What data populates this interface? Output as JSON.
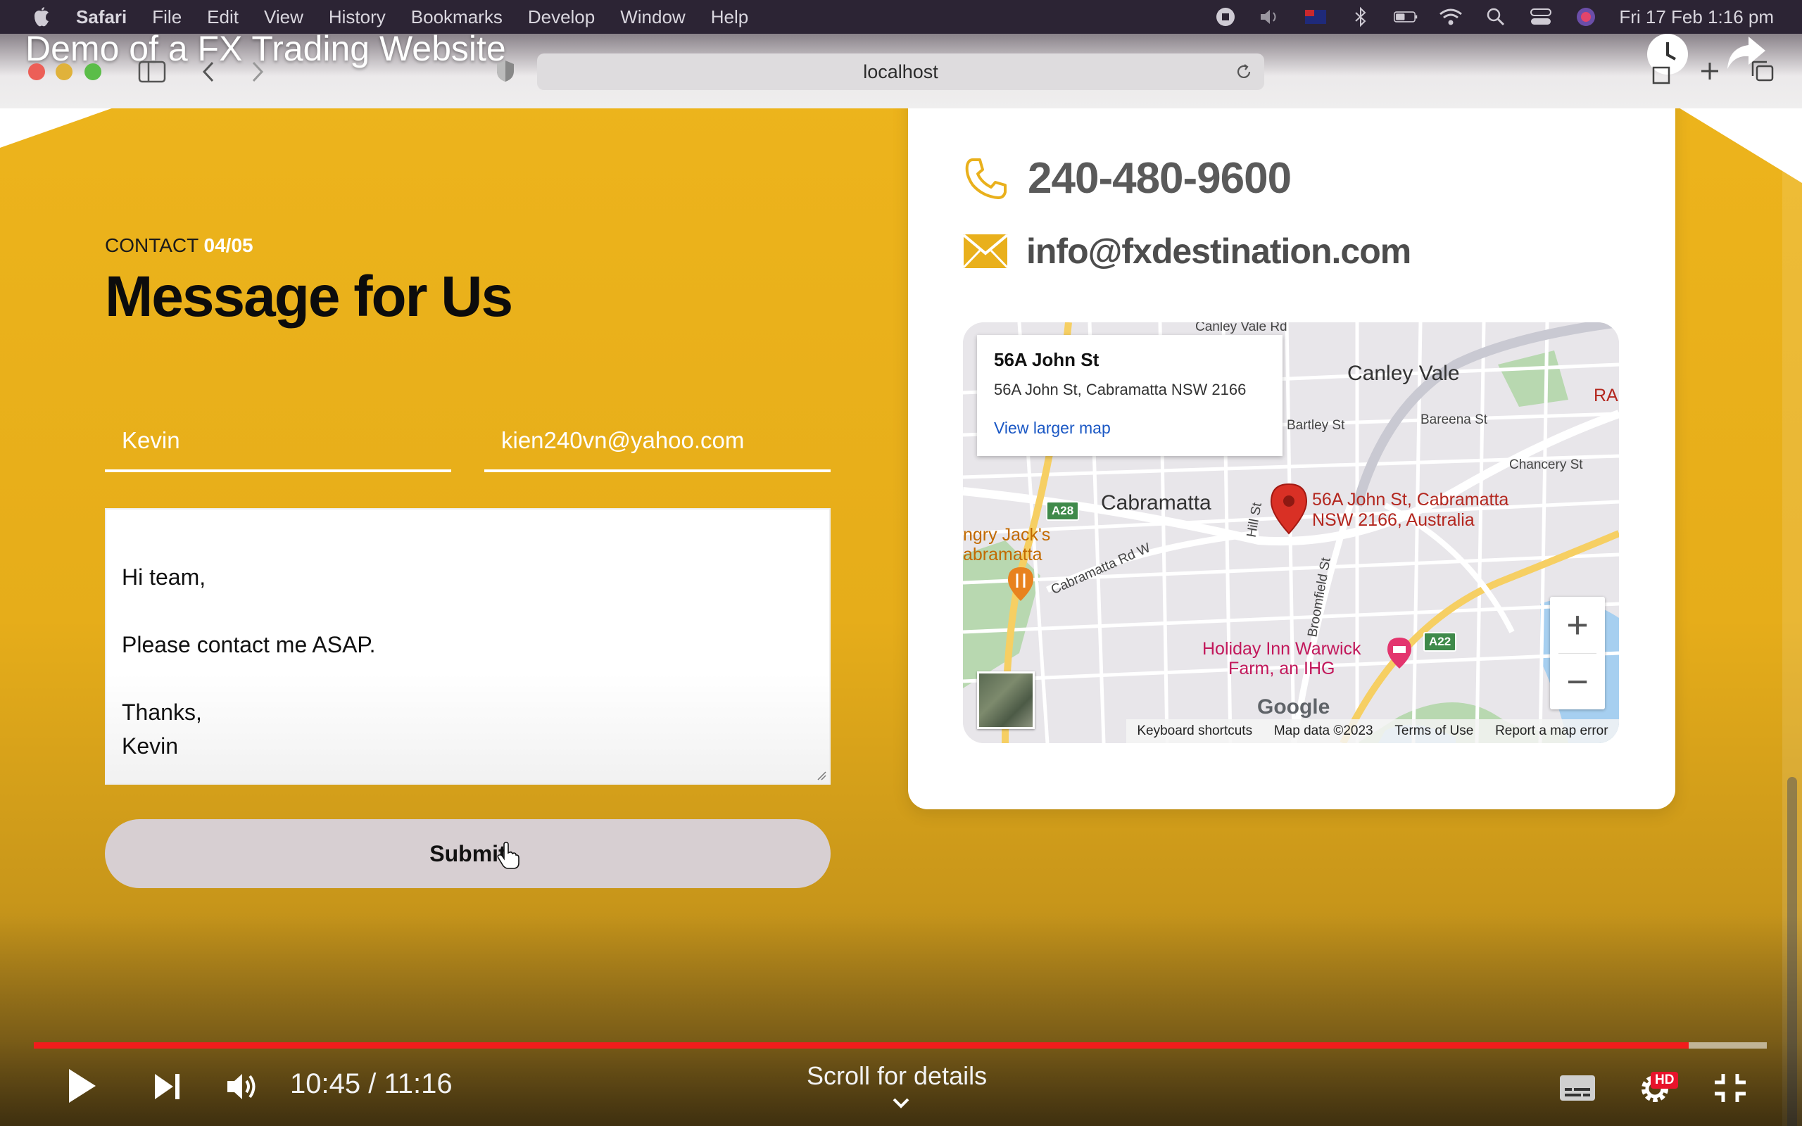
{
  "menubar": {
    "app": "Safari",
    "items": [
      "File",
      "Edit",
      "View",
      "History",
      "Bookmarks",
      "Develop",
      "Window",
      "Help"
    ],
    "clock": "Fri 17 Feb  1:16 pm"
  },
  "video": {
    "title": "Demo of a FX Trading Website",
    "time": "10:45 / 11:16",
    "progress_fraction": 0.955,
    "scroll_hint": "Scroll for details",
    "quality_badge": "HD"
  },
  "browser": {
    "url": "localhost"
  },
  "contact": {
    "eyebrow_label": "CONTACT",
    "eyebrow_number": "04/05",
    "heading": "Message for Us",
    "name_value": "Kevin",
    "email_value": "kien240vn@yahoo.com",
    "message_value": "Hi team,\n\nPlease contact me ASAP.\n\nThanks,\nKevin",
    "submit_label": "Submit"
  },
  "card": {
    "phone": "240-480-9600",
    "email": "info@fxdestination.com"
  },
  "map": {
    "info_title": "56A John St",
    "info_address": "56A John St, Cabramatta NSW 2166",
    "info_link": "View larger map",
    "pin_label_1": "56A John St, Cabramatta",
    "pin_label_2": "NSW 2166, Australia",
    "place_canley_vale": "Canley Vale",
    "place_cabramatta": "Cabramatta",
    "road_canley_vale_rd": "Canley Vale Rd",
    "road_bartley": "Bartley St",
    "road_bareena": "Bareena St",
    "road_chancery": "Chancery St",
    "road_hill": "Hill St",
    "road_cabramatta_rd": "Cabramatta Rd W",
    "road_broomfield": "Broomfield St",
    "poi_restaurant_1": "ngry Jack's",
    "poi_restaurant_2": "abramatta",
    "poi_hotel_1": "Holiday Inn Warwick",
    "poi_hotel_2": "Farm, an IHG",
    "shield_a28": "A28",
    "shield_a22": "A22",
    "edge_ra": "RA",
    "zoom_in": "+",
    "zoom_out": "−",
    "google": "Google",
    "attrib_shortcuts": "Keyboard shortcuts",
    "attrib_data": "Map data ©2023",
    "attrib_terms": "Terms of Use",
    "attrib_report": "Report a map error"
  },
  "colors": {
    "page_yellow": "#eeb51c",
    "progress_red": "#f21c1c",
    "pin_red": "#d93025",
    "link_blue": "#1a57c4",
    "icon_gold": "#e9b01c"
  }
}
